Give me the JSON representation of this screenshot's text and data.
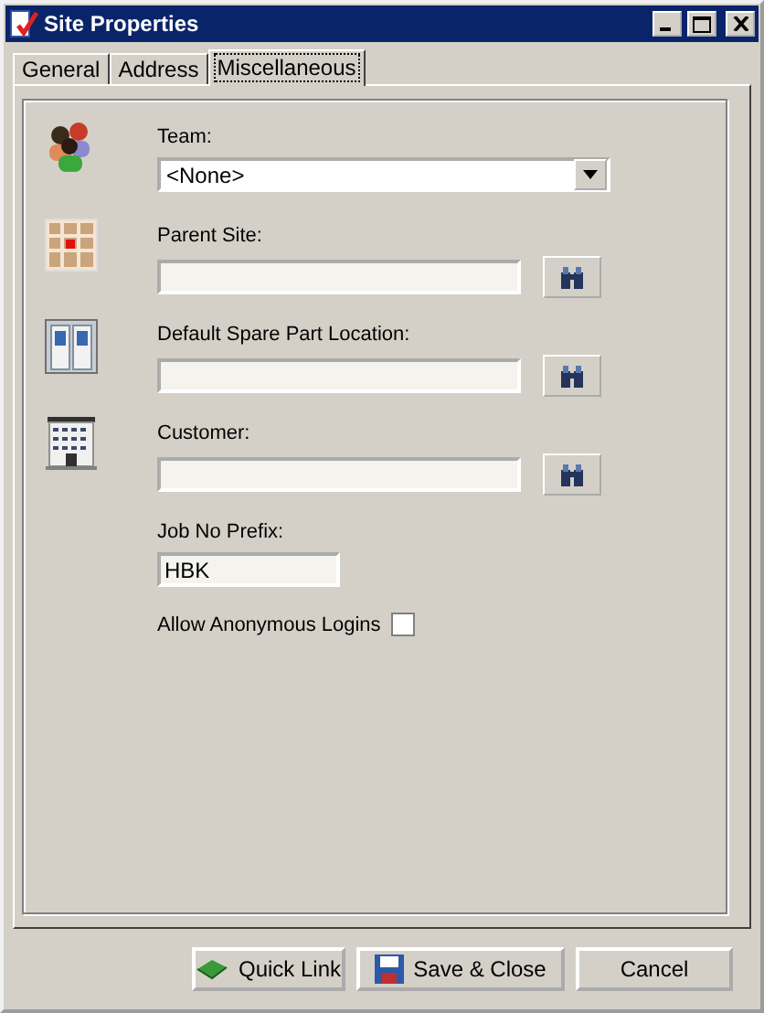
{
  "window": {
    "title": "Site Properties"
  },
  "tabs": [
    {
      "label": "General",
      "selected": false
    },
    {
      "label": "Address",
      "selected": false
    },
    {
      "label": "Miscellaneous",
      "selected": true
    }
  ],
  "fields": [
    {
      "kind": "dropdown",
      "label": "Team:",
      "value": "<None>"
    },
    {
      "kind": "lookup",
      "label": "Parent Site:"
    },
    {
      "kind": "lookup",
      "label": "Default Spare Part Location:"
    },
    {
      "kind": "lookup",
      "label": "Customer:"
    },
    {
      "kind": "text",
      "label": "Job No Prefix:",
      "value": "HBK"
    },
    {
      "kind": "checkbox",
      "label": "Allow Anonymous Logins",
      "checked": false
    }
  ],
  "buttons": [
    {
      "kind": "quicklink",
      "label": "Quick Link"
    },
    {
      "kind": "save",
      "label": "Save & Close"
    },
    {
      "kind": "cancel",
      "label": "Cancel"
    }
  ]
}
